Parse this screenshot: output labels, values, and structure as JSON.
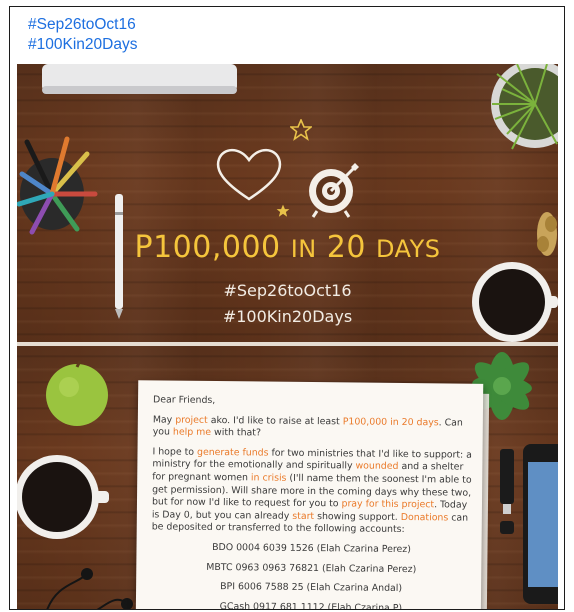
{
  "post": {
    "hashtags": [
      "#Sep26toOct16",
      "#100Kin20Days"
    ]
  },
  "hero": {
    "amount_main": "P100,000",
    "amount_in": "IN",
    "amount_num": "20",
    "amount_days": "DAYS",
    "tag1": "#Sep26toOct16",
    "tag2": "#100Kin20Days"
  },
  "letter": {
    "greeting": "Dear Friends,",
    "p1": {
      "a": "May ",
      "b": "project",
      "c": " ako. I'd like to raise at least ",
      "d": "P100,000 in 20 days",
      "e": ". Can you ",
      "f": "help me",
      "g": " with that?"
    },
    "p2": {
      "a": "I hope to ",
      "b": "generate funds",
      "c": " for two ministries that I'd like to support: a ministry for the emotionally and spiritually ",
      "d": "wounded",
      "e": " and a shelter for pregnant women ",
      "f": "in crisis",
      "g": " (I'll name them the soonest I'm able to get permission). Will share more in the coming days why these two, but for now I'd like to request for you to ",
      "h": "pray for this project",
      "i": ". Today is Day 0, but you can already ",
      "j": "start",
      "k": " showing support. ",
      "l": "Donations",
      "m": " can be deposited or transferred to the following accounts:"
    },
    "accounts": [
      "BDO 0004 6039 1526 (Elah Czarina Perez)",
      "MBTC 0963 0963 76821 (Elah Czarina Perez)",
      "BPI 6006 7588 25 (Elah Czarina Andal)",
      "GCash 0917 681 1112 (Elah Czarina P)"
    ]
  },
  "colors": {
    "hashtag": "#1d6fe0",
    "headline": "#f5c53c",
    "highlight": "#ea7a2a"
  }
}
